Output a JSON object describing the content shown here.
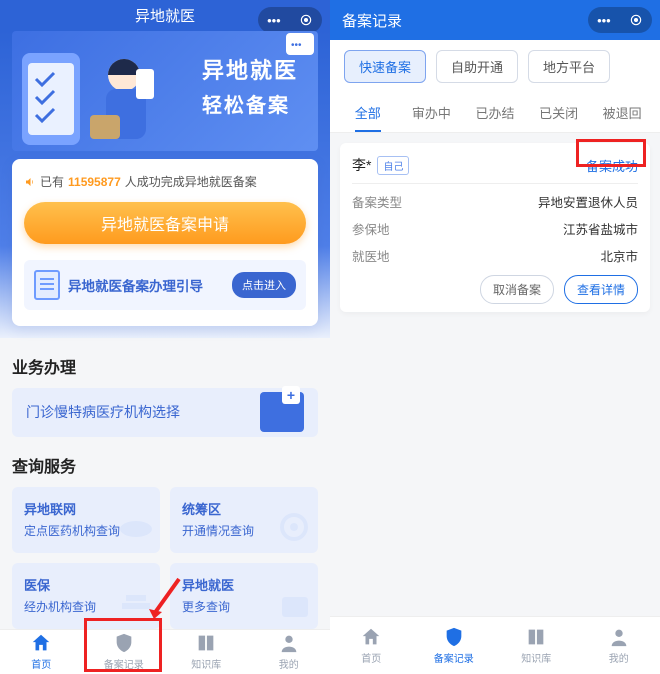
{
  "screen1": {
    "title": "异地就医",
    "banner": {
      "line1": "异地就医",
      "line2": "轻松备案"
    },
    "count": {
      "prefix": "已有",
      "number": "11595877",
      "suffix": "人成功完成异地就医备案"
    },
    "apply_button": "异地就医备案申请",
    "guide": {
      "label": "异地就医备案办理引导",
      "button": "点击进入"
    },
    "sections": {
      "biz_title": "业务办理",
      "biz_item": "门诊慢特病医疗机构选择",
      "query_title": "查询服务",
      "queries": [
        {
          "l1": "异地联网",
          "l2": "定点医药机构查询"
        },
        {
          "l1": "统筹区",
          "l2": "开通情况查询"
        },
        {
          "l1": "医保",
          "l2": "经办机构查询"
        },
        {
          "l1": "异地就医",
          "l2": "更多查询"
        }
      ]
    },
    "tabs": [
      "首页",
      "备案记录",
      "知识库",
      "我的"
    ]
  },
  "screen2": {
    "title": "备案记录",
    "pills": [
      "快速备案",
      "自助开通",
      "地方平台"
    ],
    "segs": [
      "全部",
      "审办中",
      "已办结",
      "已关闭",
      "被退回"
    ],
    "record": {
      "name": "李*",
      "self_tag": "自己",
      "status": "备案成功",
      "rows": [
        {
          "k": "备案类型",
          "v": "异地安置退休人员"
        },
        {
          "k": "参保地",
          "v": "江苏省盐城市"
        },
        {
          "k": "就医地",
          "v": "北京市"
        }
      ],
      "actions": {
        "cancel": "取消备案",
        "detail": "查看详情"
      }
    },
    "tabs": [
      "首页",
      "备案记录",
      "知识库",
      "我的"
    ]
  }
}
